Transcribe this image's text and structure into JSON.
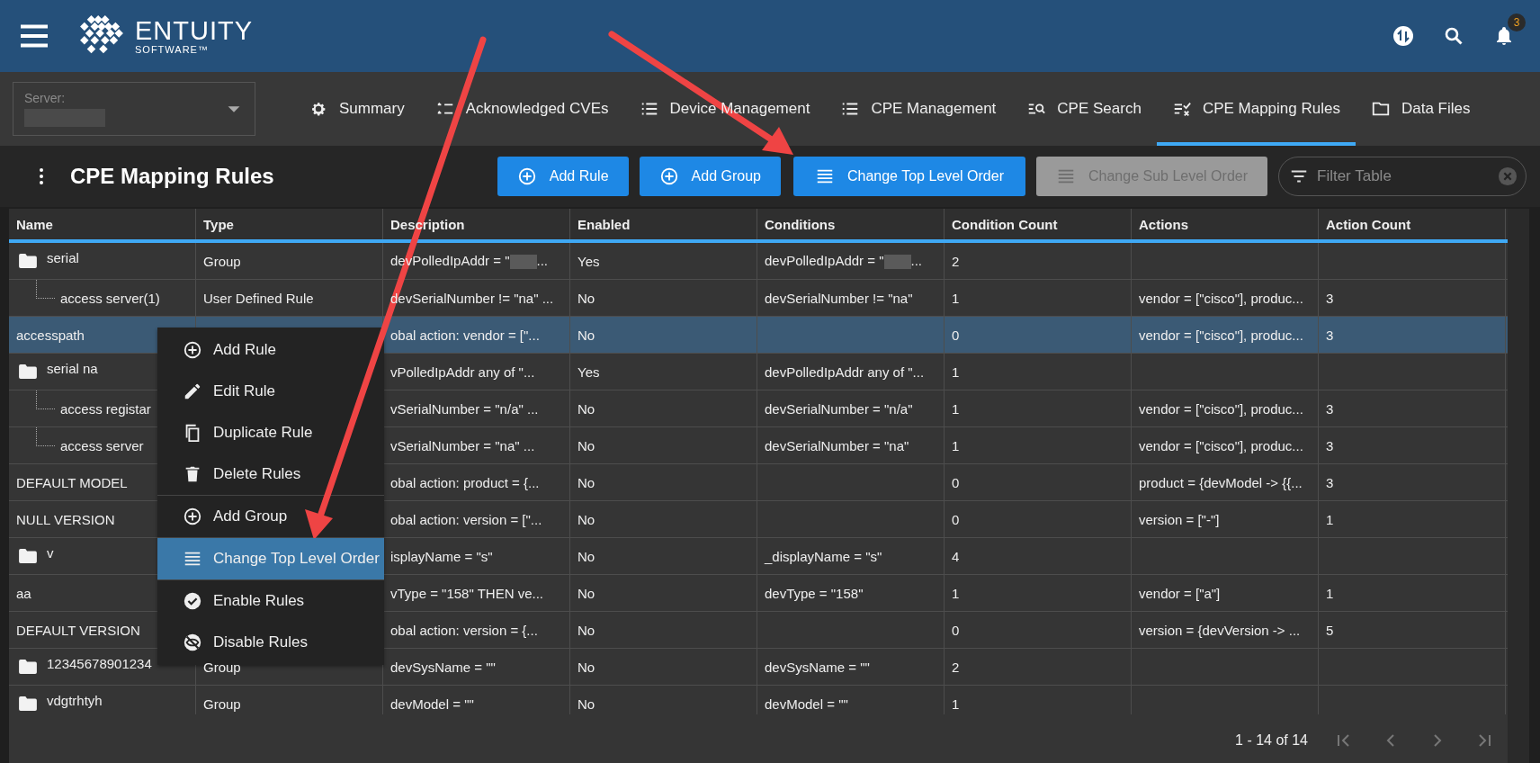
{
  "header": {
    "logo": {
      "name": "ENTUITY",
      "sub": "SOFTWARE™"
    },
    "notifications": {
      "count": "3"
    }
  },
  "server": {
    "label": "Server:",
    "redacted": true
  },
  "tabs": [
    {
      "label": "Summary",
      "selected": false
    },
    {
      "label": "Acknowledged CVEs",
      "selected": false
    },
    {
      "label": "Device Management",
      "selected": false
    },
    {
      "label": "CPE Management",
      "selected": false
    },
    {
      "label": "CPE Search",
      "selected": false
    },
    {
      "label": "CPE Mapping Rules",
      "selected": true
    },
    {
      "label": "Data Files",
      "selected": false
    }
  ],
  "page_title": "CPE Mapping Rules",
  "toolbar_buttons": [
    {
      "label": "Add Rule",
      "disabled": false
    },
    {
      "label": "Add Group",
      "disabled": false
    },
    {
      "label": "Change Top Level Order",
      "disabled": false
    },
    {
      "label": "Change Sub Level Order",
      "disabled": true
    }
  ],
  "filter": {
    "placeholder": "Filter Table"
  },
  "table": {
    "columns": [
      "Name",
      "Type",
      "Description",
      "Enabled",
      "Conditions",
      "Condition Count",
      "Actions",
      "Action Count"
    ],
    "rows": [
      {
        "name": "serial",
        "kind": "group",
        "selected": false,
        "type": "Group",
        "description": {
          "text": "devPolledIpAddr = \"",
          "redacted": true,
          "tail": "..."
        },
        "enabled": "Yes",
        "conditions": {
          "text": "devPolledIpAddr = \"",
          "redacted": true,
          "tail": "..."
        },
        "condition_count": "2",
        "children": [
          {
            "name": "access server(1)",
            "kind": "rule",
            "selected": false,
            "type": "User Defined Rule",
            "description": "devSerialNumber != \"na\" ...",
            "enabled": "No",
            "conditions": "devSerialNumber != \"na\"",
            "condition_count": "1",
            "actions": "vendor = [\"cisco\"], produc...",
            "action_count": "3"
          }
        ]
      },
      {
        "name": "accesspath",
        "kind": "rule",
        "selected": true,
        "description": "obal action: vendor = [\"...",
        "enabled": "No",
        "condition_count": "0",
        "actions": "vendor = [\"cisco\"], produc...",
        "action_count": "3"
      },
      {
        "name": "serial na",
        "kind": "group",
        "selected": false,
        "description": "vPolledIpAddr any of \"...",
        "enabled": "Yes",
        "conditions": "devPolledIpAddr any of \"...",
        "condition_count": "1",
        "children": [
          {
            "name": "access registar",
            "kind": "rule",
            "selected": false,
            "description": "vSerialNumber = \"n/a\" ...",
            "enabled": "No",
            "conditions": "devSerialNumber = \"n/a\"",
            "condition_count": "1",
            "actions": "vendor = [\"cisco\"], produc...",
            "action_count": "3"
          },
          {
            "name": "access server",
            "kind": "rule",
            "selected": false,
            "description": "vSerialNumber = \"na\" ...",
            "enabled": "No",
            "conditions": "devSerialNumber = \"na\"",
            "condition_count": "1",
            "actions": "vendor = [\"cisco\"], produc...",
            "action_count": "3"
          }
        ]
      },
      {
        "name": "DEFAULT MODEL",
        "kind": "rule",
        "selected": false,
        "description": "obal action: product = {...",
        "enabled": "No",
        "condition_count": "0",
        "actions": "product = {devModel -> {{...",
        "action_count": "3"
      },
      {
        "name": "NULL VERSION",
        "kind": "rule",
        "selected": false,
        "description": "obal action: version = [\"...",
        "enabled": "No",
        "condition_count": "0",
        "actions": "version = [\"-\"]",
        "action_count": "1"
      },
      {
        "name": "v",
        "kind": "group",
        "selected": false,
        "description": "isplayName = \"s\"",
        "enabled": "No",
        "conditions": "_displayName = \"s\"",
        "condition_count": "4"
      },
      {
        "name": "aa",
        "kind": "rule",
        "selected": false,
        "description": "vType = \"158\" THEN ve...",
        "enabled": "No",
        "conditions": "devType = \"158\"",
        "condition_count": "1",
        "actions": "vendor = [\"a\"]",
        "action_count": "1"
      },
      {
        "name": "DEFAULT VERSION",
        "kind": "rule",
        "selected": false,
        "description": "obal action: version = {...",
        "enabled": "No",
        "condition_count": "0",
        "actions": "version = {devVersion -> ...",
        "action_count": "5"
      },
      {
        "name": "12345678901234",
        "kind": "group",
        "selected": false,
        "type": "Group",
        "description": "devSysName = \"\"",
        "enabled": "No",
        "conditions": "devSysName = \"\"",
        "condition_count": "2"
      },
      {
        "name": "vdgtrhtyh",
        "kind": "group",
        "selected": false,
        "type": "Group",
        "description": "devModel = \"\"",
        "enabled": "No",
        "conditions": "devModel = \"\"",
        "condition_count": "1"
      }
    ]
  },
  "context_menu": {
    "items": [
      {
        "kind": "item",
        "label": "Add Rule",
        "selected": false
      },
      {
        "kind": "item",
        "label": "Edit Rule",
        "selected": false
      },
      {
        "kind": "item",
        "label": "Duplicate Rule",
        "selected": false
      },
      {
        "kind": "item",
        "label": "Delete Rules",
        "selected": false
      },
      {
        "kind": "divider"
      },
      {
        "kind": "item",
        "label": "Add Group",
        "selected": false
      },
      {
        "kind": "divider"
      },
      {
        "kind": "item",
        "label": "Change Top Level Order",
        "selected": true
      },
      {
        "kind": "divider"
      },
      {
        "kind": "item",
        "label": "Enable Rules",
        "selected": false
      },
      {
        "kind": "item",
        "label": "Disable Rules",
        "selected": false
      }
    ]
  },
  "pager": {
    "range": "1 - 14 of 14"
  }
}
